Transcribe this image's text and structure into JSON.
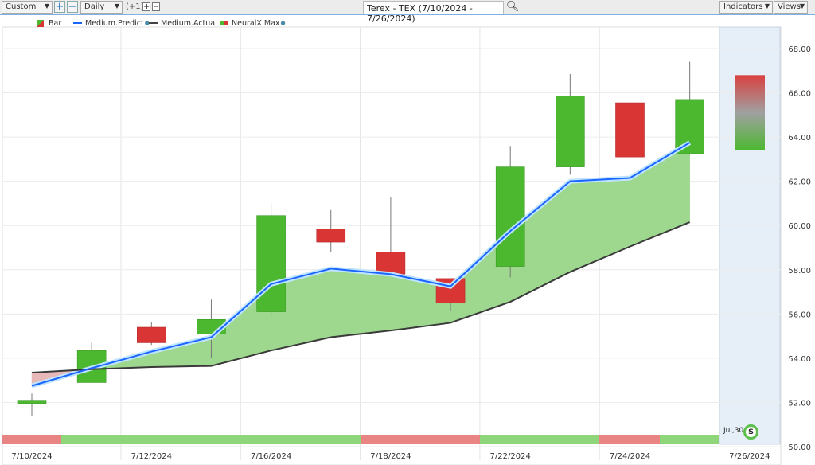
{
  "toolbar": {
    "range_select": "Custom",
    "period_select": "Daily",
    "offset": "(+1)",
    "title": "Terex - TEX (7/10/2024 - 7/26/2024)",
    "indicators": "Indicators",
    "views": "Views",
    "zoom_in": "+",
    "zoom_out": "−"
  },
  "legend": {
    "bar": "Bar",
    "predict": "Medium.Predict",
    "actual": "Medium.Actual",
    "neural": "NeuralX.Max"
  },
  "colors": {
    "up": "#4cb830",
    "down": "#d93535",
    "predict": "#1a66ff",
    "actual": "#3a3a3a",
    "fill": "#9ed88e",
    "fill_neg": "#e8b8b8",
    "forecast_bg": "#e6eef8"
  },
  "forecast_label": "Jul,30",
  "forecast_icon": "$",
  "chart_data": {
    "type": "candlestick",
    "ylim": [
      50,
      68
    ],
    "yticks": [
      "50.00",
      "52.00",
      "54.00",
      "56.00",
      "58.00",
      "60.00",
      "62.00",
      "64.00",
      "66.00",
      "68.00"
    ],
    "xticks": [
      {
        "i": 0,
        "label": "7/10/2024"
      },
      {
        "i": 2,
        "label": "7/12/2024"
      },
      {
        "i": 4,
        "label": "7/16/2024"
      },
      {
        "i": 6,
        "label": "7/18/2024"
      },
      {
        "i": 8,
        "label": "7/22/2024"
      },
      {
        "i": 10,
        "label": "7/24/2024"
      },
      {
        "i": 12,
        "label": "7/26/2024"
      }
    ],
    "candles": [
      {
        "o": 51.95,
        "h": 52.4,
        "l": 51.4,
        "c": 52.1
      },
      {
        "o": 52.9,
        "h": 54.7,
        "l": 52.9,
        "c": 54.35
      },
      {
        "o": 55.4,
        "h": 55.65,
        "l": 54.6,
        "c": 54.7
      },
      {
        "o": 55.1,
        "h": 56.65,
        "l": 54.0,
        "c": 55.75
      },
      {
        "o": 56.1,
        "h": 61.0,
        "l": 55.8,
        "c": 60.45
      },
      {
        "o": 59.85,
        "h": 60.7,
        "l": 58.8,
        "c": 59.25
      },
      {
        "o": 58.8,
        "h": 61.3,
        "l": 57.8,
        "c": 57.8
      },
      {
        "o": 57.6,
        "h": 57.6,
        "l": 56.15,
        "c": 56.5
      },
      {
        "o": 58.15,
        "h": 63.6,
        "l": 57.65,
        "c": 62.65
      },
      {
        "o": 62.65,
        "h": 66.85,
        "l": 62.3,
        "c": 65.85
      },
      {
        "o": 65.55,
        "h": 66.5,
        "l": 63.0,
        "c": 63.1
      },
      {
        "o": 63.25,
        "h": 67.4,
        "l": 63.2,
        "c": 65.7
      }
    ],
    "forecast": {
      "high": 66.8,
      "low": 63.4
    },
    "series": [
      {
        "name": "Medium.Predict",
        "values": [
          52.75,
          53.55,
          54.3,
          54.95,
          57.35,
          58.05,
          57.8,
          57.25,
          59.75,
          62.0,
          62.15,
          63.75
        ]
      },
      {
        "name": "Medium.Actual",
        "values": [
          53.35,
          53.5,
          53.6,
          53.65,
          54.35,
          54.95,
          55.25,
          55.6,
          56.55,
          57.9,
          59.05,
          60.15
        ]
      }
    ],
    "neural_strip": [
      "down",
      "up",
      "up",
      "up",
      "up",
      "up",
      "down",
      "down",
      "up",
      "up",
      "down",
      "up"
    ]
  }
}
